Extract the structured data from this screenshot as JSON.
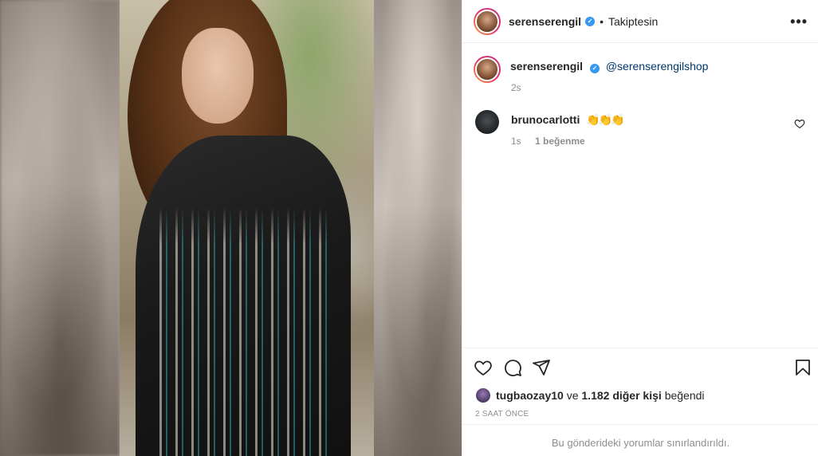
{
  "post": {
    "author": "serenserengil",
    "follow_status": "Takiptesin",
    "verified_mark": "✓",
    "dot": "•",
    "more_label": "•••"
  },
  "caption": {
    "author": "serenserengil",
    "mention": "@serenserengilshop",
    "time": "2s"
  },
  "comments": [
    {
      "author": "brunocarlotti",
      "emoji": "👏👏👏",
      "time": "1s",
      "likes": "1 beğenme"
    }
  ],
  "likes": {
    "first_user": "tugbaozay10",
    "connector": "ve",
    "others": "1.182 diğer kişi",
    "suffix": "beğendi"
  },
  "timestamp": "2 SAAT ÖNCE",
  "comments_limited_notice": "Bu gönderideki yorumlar sınırlandırıldı.",
  "icons": [
    "heart-icon",
    "comment-icon",
    "share-icon",
    "bookmark-icon",
    "more-icon",
    "verified-icon"
  ],
  "colors": {
    "verified": "#3897f0",
    "mention": "#00376b",
    "muted": "#8e8e8e",
    "text": "#262626"
  }
}
